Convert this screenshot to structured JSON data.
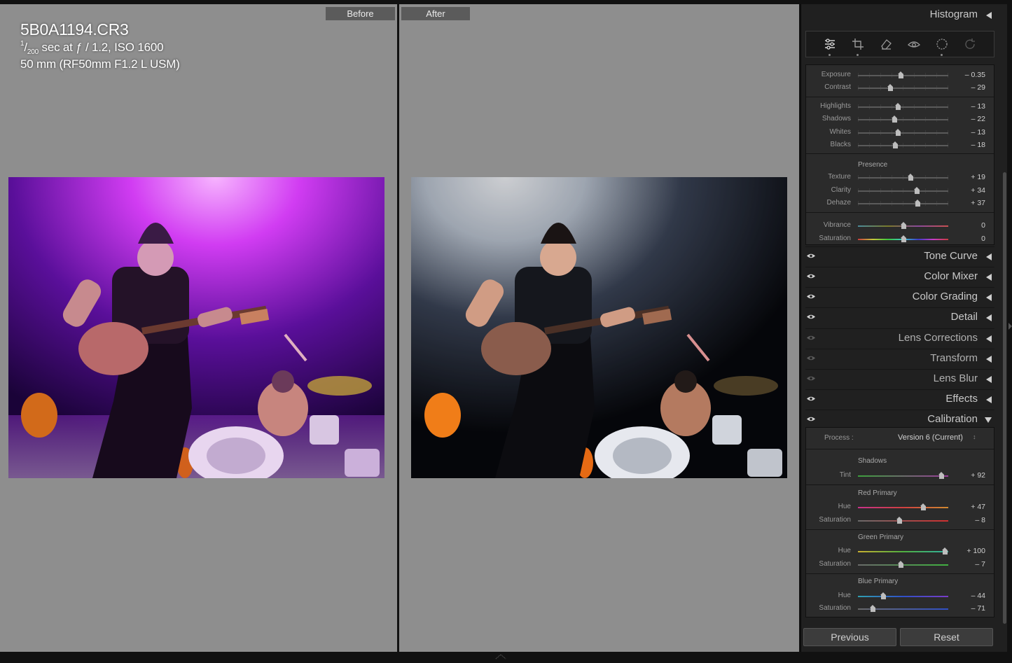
{
  "compare": {
    "before_label": "Before",
    "after_label": "After"
  },
  "info": {
    "filename": "5B0A1194.CR3",
    "shutter_num": "1",
    "shutter_den": "200",
    "exposure_rest": " sec at ƒ / 1.2, ISO 1600",
    "lens": "50 mm (RF50mm F1.2 L USM)"
  },
  "panel": {
    "histogram": "Histogram",
    "basic": {
      "exposure": {
        "label": "Exposure",
        "value": "– 0.35",
        "level": 0.47
      },
      "contrast": {
        "label": "Contrast",
        "value": "– 29",
        "level": 0.36
      },
      "highlights": {
        "label": "Highlights",
        "value": "– 13",
        "level": 0.44
      },
      "shadows": {
        "label": "Shadows",
        "value": "– 22",
        "level": 0.4
      },
      "whites": {
        "label": "Whites",
        "value": "– 13",
        "level": 0.44
      },
      "blacks": {
        "label": "Blacks",
        "value": "– 18",
        "level": 0.41
      },
      "presence": "Presence",
      "texture": {
        "label": "Texture",
        "value": "+ 19",
        "level": 0.58
      },
      "clarity": {
        "label": "Clarity",
        "value": "+ 34",
        "level": 0.65
      },
      "dehaze": {
        "label": "Dehaze",
        "value": "+ 37",
        "level": 0.66
      },
      "vibrance": {
        "label": "Vibrance",
        "value": "0",
        "level": 0.5
      },
      "saturation": {
        "label": "Saturation",
        "value": "0",
        "level": 0.5
      }
    },
    "sections": {
      "tone_curve": "Tone Curve",
      "color_mixer": "Color Mixer",
      "color_grading": "Color Grading",
      "detail": "Detail",
      "lens_corrections": "Lens Corrections",
      "transform": "Transform",
      "lens_blur": "Lens Blur",
      "effects": "Effects",
      "calibration": "Calibration"
    },
    "calibration": {
      "process_label": "Process :",
      "process_value": "Version 6 (Current)",
      "process_caret": "↕",
      "shadows_hdr": "Shadows",
      "tint": {
        "label": "Tint",
        "value": "+ 92",
        "level": 0.92
      },
      "red_hdr": "Red Primary",
      "red_hue": {
        "label": "Hue",
        "value": "+ 47",
        "level": 0.72
      },
      "red_sat": {
        "label": "Saturation",
        "value": "– 8",
        "level": 0.46
      },
      "green_hdr": "Green Primary",
      "green_hue": {
        "label": "Hue",
        "value": "+ 100",
        "level": 0.96
      },
      "green_sat": {
        "label": "Saturation",
        "value": "– 7",
        "level": 0.47
      },
      "blue_hdr": "Blue Primary",
      "blue_hue": {
        "label": "Hue",
        "value": "– 44",
        "level": 0.28
      },
      "blue_sat": {
        "label": "Saturation",
        "value": "– 71",
        "level": 0.16
      }
    },
    "buttons": {
      "previous": "Previous",
      "reset": "Reset"
    }
  }
}
